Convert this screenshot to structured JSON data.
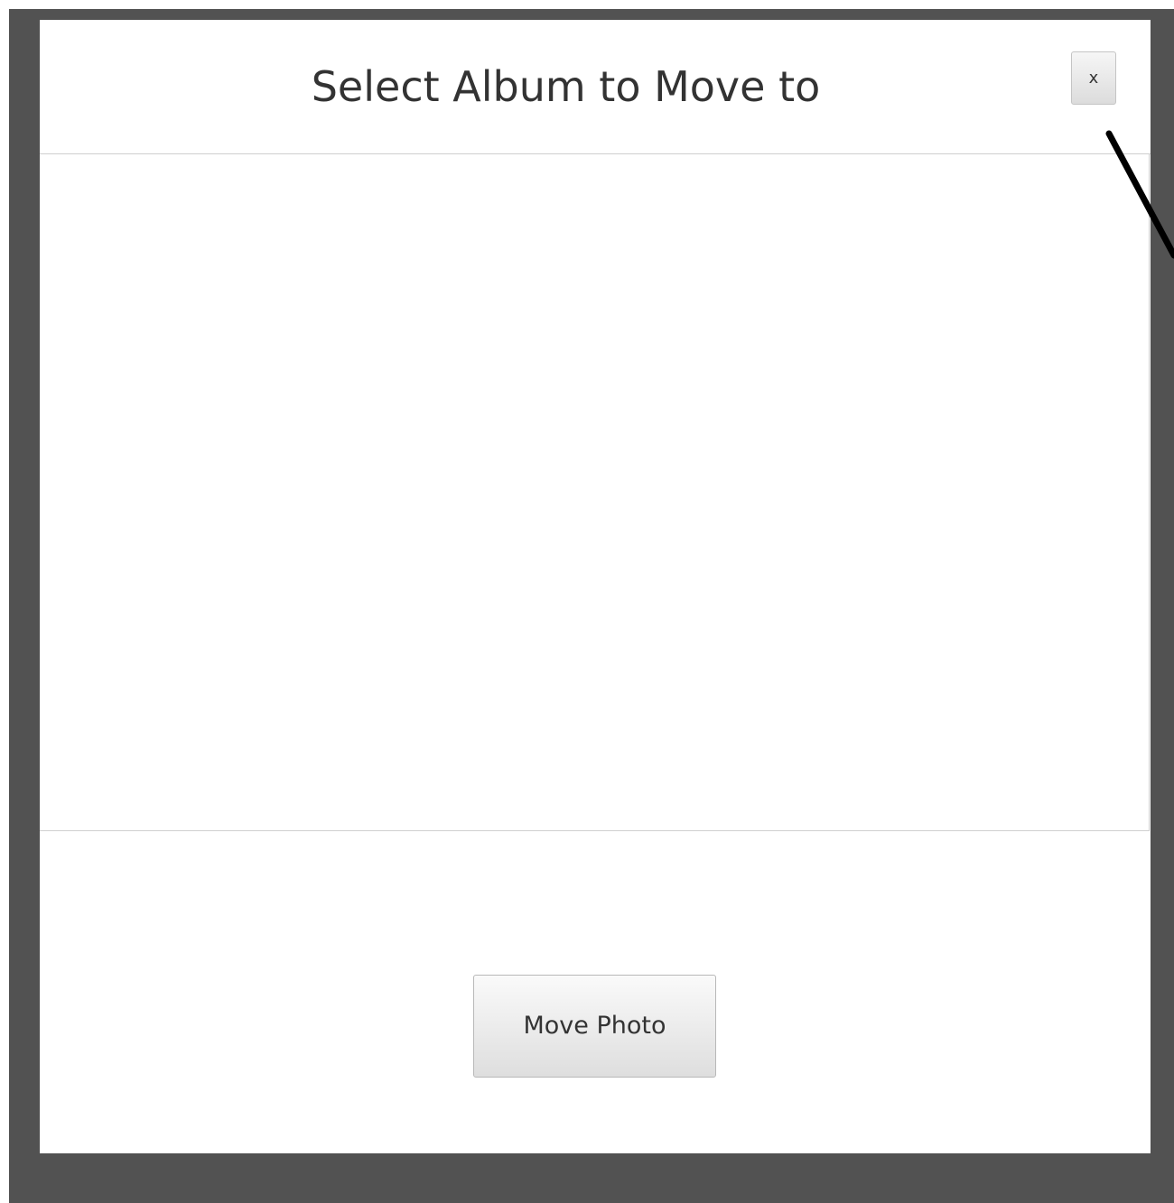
{
  "dialog": {
    "title": "Select Album to Move to",
    "close_label": "x",
    "primary_button_label": "Move Photo"
  },
  "colors": {
    "overlay": "#525252",
    "dialog_background": "#ffffff",
    "annotation": "#000000"
  }
}
